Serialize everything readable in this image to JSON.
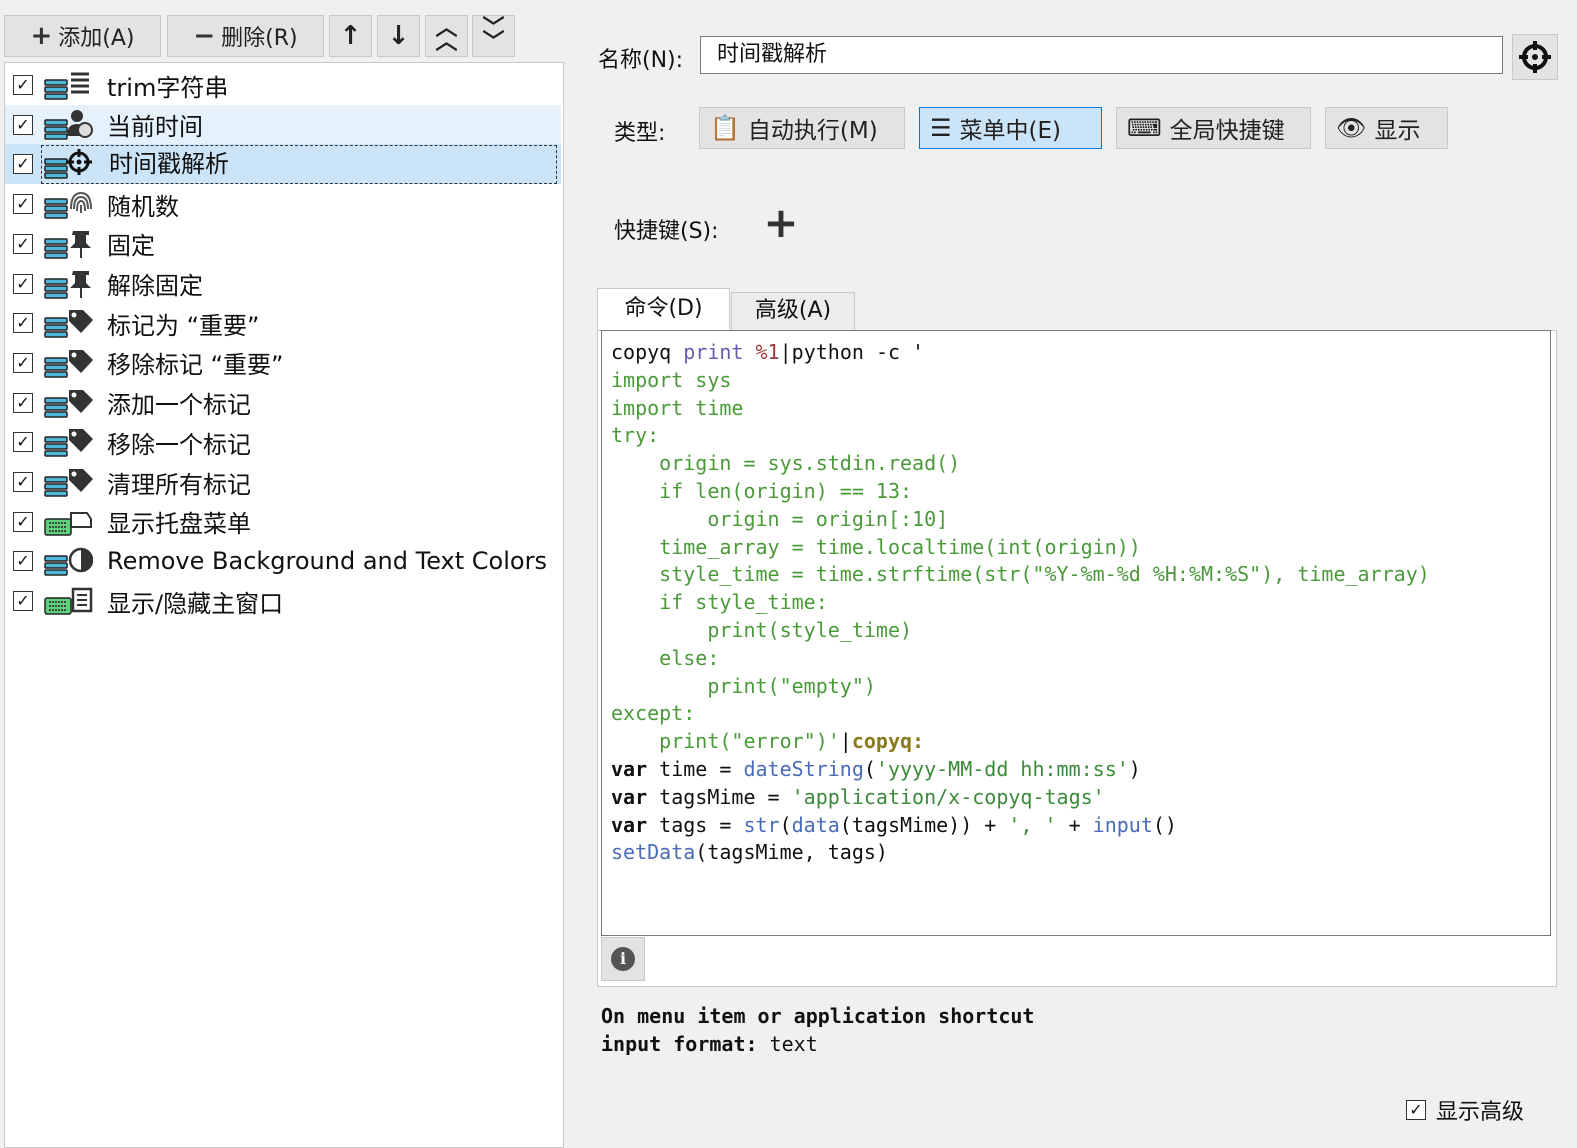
{
  "toolbar": {
    "add_label": "添加(A)",
    "remove_label": "删除(R)"
  },
  "commands": [
    {
      "label": "trim字符串",
      "checked": true,
      "icon": "trim-icon"
    },
    {
      "label": "当前时间",
      "checked": true,
      "icon": "time-icon"
    },
    {
      "label": "时间戳解析",
      "checked": true,
      "icon": "crosshair-icon"
    },
    {
      "label": "随机数",
      "checked": true,
      "icon": "fingerprint-icon"
    },
    {
      "label": "固定",
      "checked": true,
      "icon": "pin-icon"
    },
    {
      "label": "解除固定",
      "checked": true,
      "icon": "unpin-icon"
    },
    {
      "label": "标记为 “重要”",
      "checked": true,
      "icon": "tag-icon"
    },
    {
      "label": "移除标记 “重要”",
      "checked": true,
      "icon": "tag-icon"
    },
    {
      "label": "添加一个标记",
      "checked": true,
      "icon": "tag-icon"
    },
    {
      "label": "移除一个标记",
      "checked": true,
      "icon": "tag-icon"
    },
    {
      "label": "清理所有标记",
      "checked": true,
      "icon": "tag-icon"
    },
    {
      "label": "显示托盘菜单",
      "checked": true,
      "icon": "tray-menu-icon"
    },
    {
      "label": "Remove Background and Text Colors",
      "checked": true,
      "icon": "contrast-icon"
    },
    {
      "label": "显示/隐藏主窗口",
      "checked": true,
      "icon": "window-icon"
    }
  ],
  "form": {
    "name_label": "名称(N):",
    "name_value": "时间戳解析",
    "type_label": "类型:",
    "shortcut_label": "快捷键(S):",
    "types": [
      {
        "label": "自动执行(M)",
        "icon": "clipboard-icon"
      },
      {
        "label": "菜单中(E)",
        "icon": "menu-icon",
        "active": true
      },
      {
        "label": "全局快捷键",
        "icon": "keyboard-icon"
      },
      {
        "label": "显示",
        "icon": "eye-icon"
      }
    ]
  },
  "tabs": {
    "command": "命令(D)",
    "advanced": "高级(A)"
  },
  "code": [
    "copyq print %1|python -c '",
    "import sys",
    "import time",
    "try:",
    "    origin = sys.stdin.read()",
    "    if len(origin) == 13:",
    "        origin = origin[:10]",
    "    time_array = time.localtime(int(origin))",
    "    style_time = time.strftime(str(\"%Y-%m-%d %H:%M:%S\"), time_array)",
    "    if style_time:",
    "        print(style_time)",
    "    else:",
    "        print(\"empty\")",
    "except:",
    "    print(\"error\")'|copyq:",
    "var time = dateString('yyyy-MM-dd hh:mm:ss')",
    "var tagsMime = 'application/x-copyq-tags'",
    "var tags = str(data(tagsMime)) + ', ' + input()",
    "setData(tagsMime, tags)"
  ],
  "info": {
    "line1": "On menu item or application shortcut",
    "line2_key": "input format:",
    "line2_value": "text"
  },
  "show_advanced": "显示高级"
}
